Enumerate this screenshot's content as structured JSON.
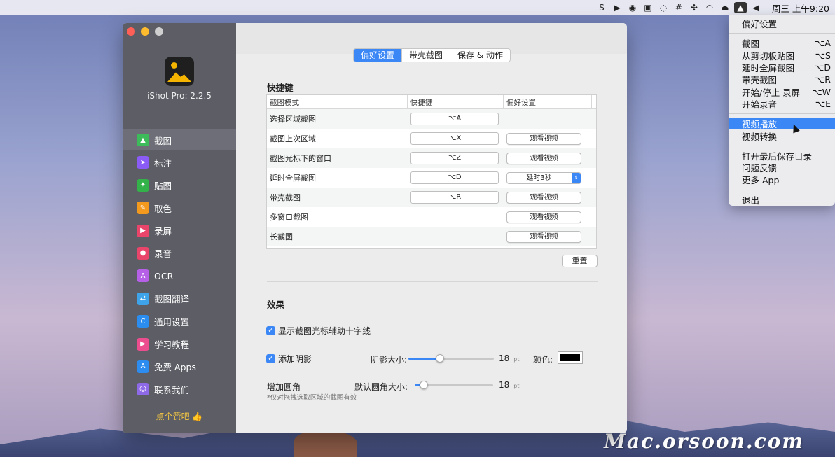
{
  "menubar": {
    "icons": [
      "s-icon",
      "play-icon",
      "wechat-icon",
      "monitor-icon",
      "chat-icon",
      "grid-icon",
      "network-icon",
      "wifi-icon",
      "eject-icon",
      "ishot-icon",
      "volume-icon"
    ],
    "clock": "周三 上午9:20"
  },
  "window": {
    "app_version": "iShot Pro: 2.2.5",
    "nav": [
      {
        "label": "截图",
        "color": "#3dbb5a",
        "icon": "▲"
      },
      {
        "label": "标注",
        "color": "#8a5cf5",
        "icon": "➤"
      },
      {
        "label": "贴图",
        "color": "#34b24a",
        "icon": "✦"
      },
      {
        "label": "取色",
        "color": "#f39a1e",
        "icon": "✎"
      },
      {
        "label": "录屏",
        "color": "#e9456a",
        "icon": "▶"
      },
      {
        "label": "录音",
        "color": "#e9456a",
        "icon": "●"
      },
      {
        "label": "OCR",
        "color": "#b560e6",
        "icon": "A"
      },
      {
        "label": "截图翻译",
        "color": "#3fa3ea",
        "icon": "⇄"
      },
      {
        "label": "通用设置",
        "color": "#2c8df0",
        "icon": "C"
      },
      {
        "label": "学习教程",
        "color": "#ec4d8f",
        "icon": "▶"
      },
      {
        "label": "免费 Apps",
        "color": "#2d8cf0",
        "icon": "A"
      },
      {
        "label": "联系我们",
        "color": "#8e6ae8",
        "icon": "☺"
      }
    ],
    "like": "点个赞吧 👍",
    "tabs": [
      "偏好设置",
      "带壳截图",
      "保存 & 动作"
    ],
    "shortcut_section": "快捷键",
    "table_headers": [
      "截图模式",
      "快捷键",
      "偏好设置"
    ],
    "table_rows": [
      {
        "mode": "选择区域截图",
        "key": "⌥A",
        "pref": ""
      },
      {
        "mode": "截图上次区域",
        "key": "⌥X",
        "pref": "观看视频"
      },
      {
        "mode": "截图光标下的窗口",
        "key": "⌥Z",
        "pref": "观看视频"
      },
      {
        "mode": "延时全屏截图",
        "key": "⌥D",
        "pref": "延时3秒"
      },
      {
        "mode": "带壳截图",
        "key": "⌥R",
        "pref": "观看视频"
      },
      {
        "mode": "多窗口截图",
        "key": "",
        "pref": "观看视频"
      },
      {
        "mode": "长截图",
        "key": "",
        "pref": "观看视频"
      }
    ],
    "reset": "重置",
    "effects_section": "效果",
    "crosshair_label": "显示截图光标辅助十字线",
    "shadow_label": "添加阴影",
    "shadow_size_label": "阴影大小:",
    "shadow_size_value": "18",
    "shadow_size_fraction": 0.37,
    "unit": "pt",
    "color_label": "颜色:",
    "shadow_color": "#000000",
    "corner_label": "增加圆角",
    "corner_size_label": "默认圆角大小:",
    "corner_size_value": "18",
    "corner_size_fraction": 0.12,
    "note": "*仅对拖拽选取区域的截图有效"
  },
  "menu": {
    "groups": [
      [
        {
          "label": "偏好设置",
          "shortcut": ""
        }
      ],
      [
        {
          "label": "截图",
          "shortcut": "⌥A"
        },
        {
          "label": "从剪切板贴图",
          "shortcut": "⌥S"
        },
        {
          "label": "延时全屏截图",
          "shortcut": "⌥D"
        },
        {
          "label": "带壳截图",
          "shortcut": "⌥R"
        },
        {
          "label": "开始/停止 录屏",
          "shortcut": "⌥W"
        },
        {
          "label": "开始录音",
          "shortcut": "⌥E"
        }
      ],
      [
        {
          "label": "视频播放",
          "shortcut": "",
          "highlight": true
        },
        {
          "label": "视频转换",
          "shortcut": ""
        }
      ],
      [
        {
          "label": "打开最后保存目录",
          "shortcut": ""
        },
        {
          "label": "问题反馈",
          "shortcut": ""
        },
        {
          "label": "更多 App",
          "shortcut": ""
        }
      ],
      [
        {
          "label": "退出",
          "shortcut": ""
        }
      ]
    ]
  },
  "watermark": "Mac.orsoon.com"
}
